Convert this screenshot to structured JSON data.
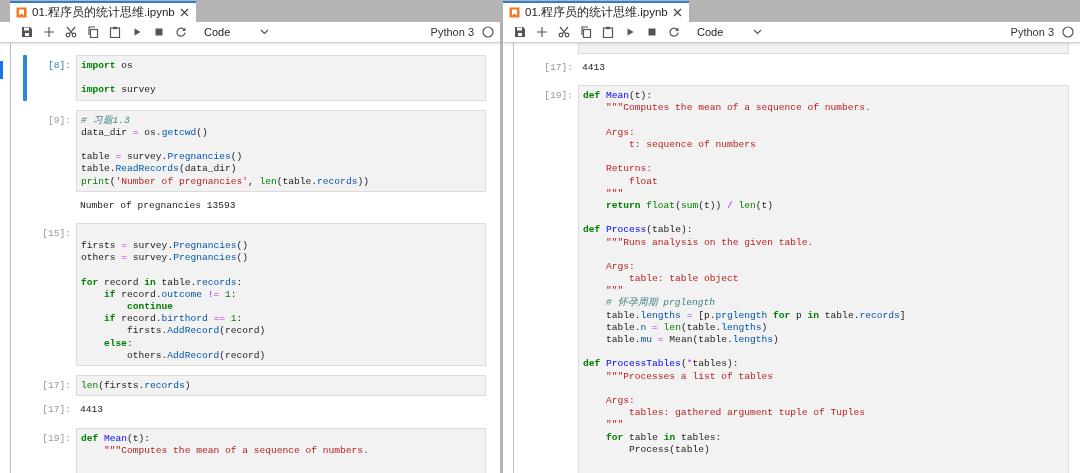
{
  "panes": [
    {
      "tab": {
        "title": "01.程序员的统计思维.ipynb"
      },
      "toolbar": {
        "cell_type": "Code",
        "kernel": "Python 3"
      },
      "cells": [
        {
          "kind": "code",
          "prompt": "[8]:",
          "selected": true,
          "lines": [
            {
              "kind": "code",
              "tokens": [
                {
                  "kind": "keyword",
                  "text": "import"
                },
                {
                  "kind": "plain",
                  "text": " os"
                }
              ]
            },
            {
              "kind": "blank"
            },
            {
              "kind": "code",
              "tokens": [
                {
                  "kind": "keyword",
                  "text": "import"
                },
                {
                  "kind": "plain",
                  "text": " survey"
                }
              ]
            }
          ]
        },
        {
          "kind": "code",
          "prompt": "[9]:",
          "selected": false,
          "lines": [
            {
              "kind": "code",
              "tokens": [
                {
                  "kind": "comment",
                  "text": "# 习题1.3"
                }
              ]
            },
            {
              "kind": "code",
              "tokens": [
                {
                  "kind": "plain",
                  "text": "data_dir "
                },
                {
                  "kind": "operator",
                  "text": "="
                },
                {
                  "kind": "plain",
                  "text": " os."
                },
                {
                  "kind": "attribute",
                  "text": "getcwd"
                },
                {
                  "kind": "plain",
                  "text": "()"
                }
              ]
            },
            {
              "kind": "blank"
            },
            {
              "kind": "code",
              "tokens": [
                {
                  "kind": "plain",
                  "text": "table "
                },
                {
                  "kind": "operator",
                  "text": "="
                },
                {
                  "kind": "plain",
                  "text": " survey."
                },
                {
                  "kind": "attribute",
                  "text": "Pregnancies"
                },
                {
                  "kind": "plain",
                  "text": "()"
                }
              ]
            },
            {
              "kind": "code",
              "tokens": [
                {
                  "kind": "plain",
                  "text": "table."
                },
                {
                  "kind": "attribute",
                  "text": "ReadRecords"
                },
                {
                  "kind": "plain",
                  "text": "(data_dir)"
                }
              ]
            },
            {
              "kind": "code",
              "tokens": [
                {
                  "kind": "builtin",
                  "text": "print"
                },
                {
                  "kind": "plain",
                  "text": "("
                },
                {
                  "kind": "string",
                  "text": "'Number of pregnancies'"
                },
                {
                  "kind": "plain",
                  "text": ", "
                },
                {
                  "kind": "builtin",
                  "text": "len"
                },
                {
                  "kind": "plain",
                  "text": "(table."
                },
                {
                  "kind": "attribute",
                  "text": "records"
                },
                {
                  "kind": "plain",
                  "text": "))"
                }
              ]
            }
          ]
        },
        {
          "kind": "output",
          "text": "Number of pregnancies 13593"
        },
        {
          "kind": "code",
          "prompt": "[15]:",
          "selected": false,
          "lines": [
            {
              "kind": "blank"
            },
            {
              "kind": "code",
              "tokens": [
                {
                  "kind": "plain",
                  "text": "firsts "
                },
                {
                  "kind": "operator",
                  "text": "="
                },
                {
                  "kind": "plain",
                  "text": " survey."
                },
                {
                  "kind": "attribute",
                  "text": "Pregnancies"
                },
                {
                  "kind": "plain",
                  "text": "()"
                }
              ]
            },
            {
              "kind": "code",
              "tokens": [
                {
                  "kind": "plain",
                  "text": "others "
                },
                {
                  "kind": "operator",
                  "text": "="
                },
                {
                  "kind": "plain",
                  "text": " survey."
                },
                {
                  "kind": "attribute",
                  "text": "Pregnancies"
                },
                {
                  "kind": "plain",
                  "text": "()"
                }
              ]
            },
            {
              "kind": "blank"
            },
            {
              "kind": "code",
              "tokens": [
                {
                  "kind": "keyword",
                  "text": "for"
                },
                {
                  "kind": "plain",
                  "text": " record "
                },
                {
                  "kind": "keyword",
                  "text": "in"
                },
                {
                  "kind": "plain",
                  "text": " table."
                },
                {
                  "kind": "attribute",
                  "text": "records"
                },
                {
                  "kind": "plain",
                  "text": ":"
                }
              ]
            },
            {
              "kind": "code",
              "tokens": [
                {
                  "kind": "keyword",
                  "text": "    if"
                },
                {
                  "kind": "plain",
                  "text": " record."
                },
                {
                  "kind": "attribute",
                  "text": "outcome"
                },
                {
                  "kind": "operator",
                  "text": " !="
                },
                {
                  "kind": "number",
                  "text": " 1"
                },
                {
                  "kind": "plain",
                  "text": ":"
                }
              ]
            },
            {
              "kind": "code",
              "tokens": [
                {
                  "kind": "keyword",
                  "text": "        continue"
                }
              ]
            },
            {
              "kind": "code",
              "tokens": [
                {
                  "kind": "keyword",
                  "text": "    if"
                },
                {
                  "kind": "plain",
                  "text": " record."
                },
                {
                  "kind": "attribute",
                  "text": "birthord"
                },
                {
                  "kind": "operator",
                  "text": " =="
                },
                {
                  "kind": "number",
                  "text": " 1"
                },
                {
                  "kind": "plain",
                  "text": ":"
                }
              ]
            },
            {
              "kind": "code",
              "tokens": [
                {
                  "kind": "plain",
                  "text": "        firsts."
                },
                {
                  "kind": "attribute",
                  "text": "AddRecord"
                },
                {
                  "kind": "plain",
                  "text": "(record)"
                }
              ]
            },
            {
              "kind": "code",
              "tokens": [
                {
                  "kind": "keyword",
                  "text": "    else"
                },
                {
                  "kind": "plain",
                  "text": ":"
                }
              ]
            },
            {
              "kind": "code",
              "tokens": [
                {
                  "kind": "plain",
                  "text": "        others."
                },
                {
                  "kind": "attribute",
                  "text": "AddRecord"
                },
                {
                  "kind": "plain",
                  "text": "(record)"
                }
              ]
            }
          ]
        },
        {
          "kind": "code",
          "prompt": "[17]:",
          "selected": false,
          "lines": [
            {
              "kind": "code",
              "tokens": [
                {
                  "kind": "builtin",
                  "text": "len"
                },
                {
                  "kind": "plain",
                  "text": "(firsts."
                },
                {
                  "kind": "attribute",
                  "text": "records"
                },
                {
                  "kind": "plain",
                  "text": ")"
                }
              ]
            }
          ]
        },
        {
          "kind": "output",
          "prompt": "[17]:",
          "text": "4413"
        },
        {
          "kind": "code",
          "prompt": "[19]:",
          "selected": false,
          "lines": [
            {
              "kind": "code",
              "tokens": [
                {
                  "kind": "keyword",
                  "text": "def"
                },
                {
                  "kind": "function",
                  "text": " Mean"
                },
                {
                  "kind": "plain",
                  "text": "(t):"
                }
              ]
            },
            {
              "kind": "code",
              "tokens": [
                {
                  "kind": "string",
                  "text": "    \"\"\"Computes the mean of a sequence of numbers."
                }
              ]
            }
          ]
        }
      ]
    },
    {
      "tab": {
        "title": "01.程序员的统计思维.ipynb"
      },
      "toolbar": {
        "cell_type": "Code",
        "kernel": "Python 3"
      },
      "cells": [
        {
          "kind": "code",
          "selected": false
        },
        {
          "kind": "output",
          "prompt": "[17]:",
          "text": "4413"
        },
        {
          "kind": "code",
          "prompt": "[19]:",
          "selected": false,
          "lines": [
            {
              "kind": "code",
              "tokens": [
                {
                  "kind": "keyword",
                  "text": "def"
                },
                {
                  "kind": "function",
                  "text": " Mean"
                },
                {
                  "kind": "plain",
                  "text": "(t):"
                }
              ]
            },
            {
              "kind": "code",
              "tokens": [
                {
                  "kind": "string",
                  "text": "    \"\"\"Computes the mean of a sequence of numbers."
                }
              ]
            },
            {
              "kind": "blank"
            },
            {
              "kind": "code",
              "tokens": [
                {
                  "kind": "string",
                  "text": "    Args:"
                }
              ]
            },
            {
              "kind": "code",
              "tokens": [
                {
                  "kind": "string",
                  "text": "        t: sequence of numbers"
                }
              ]
            },
            {
              "kind": "blank"
            },
            {
              "kind": "code",
              "tokens": [
                {
                  "kind": "string",
                  "text": "    Returns:"
                }
              ]
            },
            {
              "kind": "code",
              "tokens": [
                {
                  "kind": "string",
                  "text": "        float"
                }
              ]
            },
            {
              "kind": "code",
              "tokens": [
                {
                  "kind": "string",
                  "text": "    \"\"\""
                }
              ]
            },
            {
              "kind": "code",
              "tokens": [
                {
                  "kind": "keyword",
                  "text": "    return"
                },
                {
                  "kind": "builtin",
                  "text": " float"
                },
                {
                  "kind": "plain",
                  "text": "("
                },
                {
                  "kind": "builtin",
                  "text": "sum"
                },
                {
                  "kind": "plain",
                  "text": "(t))"
                },
                {
                  "kind": "operator",
                  "text": " /"
                },
                {
                  "kind": "builtin",
                  "text": " len"
                },
                {
                  "kind": "plain",
                  "text": "(t)"
                }
              ]
            },
            {
              "kind": "blank"
            },
            {
              "kind": "code",
              "tokens": [
                {
                  "kind": "keyword",
                  "text": "def"
                },
                {
                  "kind": "function",
                  "text": " Process"
                },
                {
                  "kind": "plain",
                  "text": "(table):"
                }
              ]
            },
            {
              "kind": "code",
              "tokens": [
                {
                  "kind": "string",
                  "text": "    \"\"\"Runs analysis on the given table."
                }
              ]
            },
            {
              "kind": "blank"
            },
            {
              "kind": "code",
              "tokens": [
                {
                  "kind": "string",
                  "text": "    Args:"
                }
              ]
            },
            {
              "kind": "code",
              "tokens": [
                {
                  "kind": "string",
                  "text": "        table: table object"
                }
              ]
            },
            {
              "kind": "code",
              "tokens": [
                {
                  "kind": "string",
                  "text": "    \"\"\""
                }
              ]
            },
            {
              "kind": "code",
              "tokens": [
                {
                  "kind": "comment",
                  "text": "    # 怀孕周期 prglength"
                }
              ]
            },
            {
              "kind": "code",
              "tokens": [
                {
                  "kind": "plain",
                  "text": "    table."
                },
                {
                  "kind": "attribute",
                  "text": "lengths"
                },
                {
                  "kind": "operator",
                  "text": " ="
                },
                {
                  "kind": "plain",
                  "text": " [p."
                },
                {
                  "kind": "attribute",
                  "text": "prglength"
                },
                {
                  "kind": "keyword",
                  "text": " for"
                },
                {
                  "kind": "plain",
                  "text": " p "
                },
                {
                  "kind": "keyword",
                  "text": "in"
                },
                {
                  "kind": "plain",
                  "text": " table."
                },
                {
                  "kind": "attribute",
                  "text": "records"
                },
                {
                  "kind": "plain",
                  "text": "]"
                }
              ]
            },
            {
              "kind": "code",
              "tokens": [
                {
                  "kind": "plain",
                  "text": "    table."
                },
                {
                  "kind": "attribute",
                  "text": "n"
                },
                {
                  "kind": "operator",
                  "text": " ="
                },
                {
                  "kind": "builtin",
                  "text": " len"
                },
                {
                  "kind": "plain",
                  "text": "(table."
                },
                {
                  "kind": "attribute",
                  "text": "lengths"
                },
                {
                  "kind": "plain",
                  "text": ")"
                }
              ]
            },
            {
              "kind": "code",
              "tokens": [
                {
                  "kind": "plain",
                  "text": "    table."
                },
                {
                  "kind": "attribute",
                  "text": "mu"
                },
                {
                  "kind": "operator",
                  "text": " ="
                },
                {
                  "kind": "plain",
                  "text": " Mean(table."
                },
                {
                  "kind": "attribute",
                  "text": "lengths"
                },
                {
                  "kind": "plain",
                  "text": ")"
                }
              ]
            },
            {
              "kind": "blank"
            },
            {
              "kind": "code",
              "tokens": [
                {
                  "kind": "keyword",
                  "text": "def"
                },
                {
                  "kind": "function",
                  "text": " ProcessTables"
                },
                {
                  "kind": "plain",
                  "text": "("
                },
                {
                  "kind": "operator",
                  "text": "*"
                },
                {
                  "kind": "plain",
                  "text": "tables):"
                }
              ]
            },
            {
              "kind": "code",
              "tokens": [
                {
                  "kind": "string",
                  "text": "    \"\"\"Processes a list of tables"
                }
              ]
            },
            {
              "kind": "blank"
            },
            {
              "kind": "code",
              "tokens": [
                {
                  "kind": "string",
                  "text": "    Args:"
                }
              ]
            },
            {
              "kind": "code",
              "tokens": [
                {
                  "kind": "string",
                  "text": "        tables: gathered argument tuple of Tuples"
                }
              ]
            },
            {
              "kind": "code",
              "tokens": [
                {
                  "kind": "string",
                  "text": "    \"\"\""
                }
              ]
            },
            {
              "kind": "code",
              "tokens": [
                {
                  "kind": "keyword",
                  "text": "    for"
                },
                {
                  "kind": "plain",
                  "text": " table "
                },
                {
                  "kind": "keyword",
                  "text": "in"
                },
                {
                  "kind": "plain",
                  "text": " tables:"
                }
              ]
            },
            {
              "kind": "code",
              "tokens": [
                {
                  "kind": "plain",
                  "text": "        Process(table)"
                }
              ]
            }
          ]
        }
      ]
    }
  ]
}
